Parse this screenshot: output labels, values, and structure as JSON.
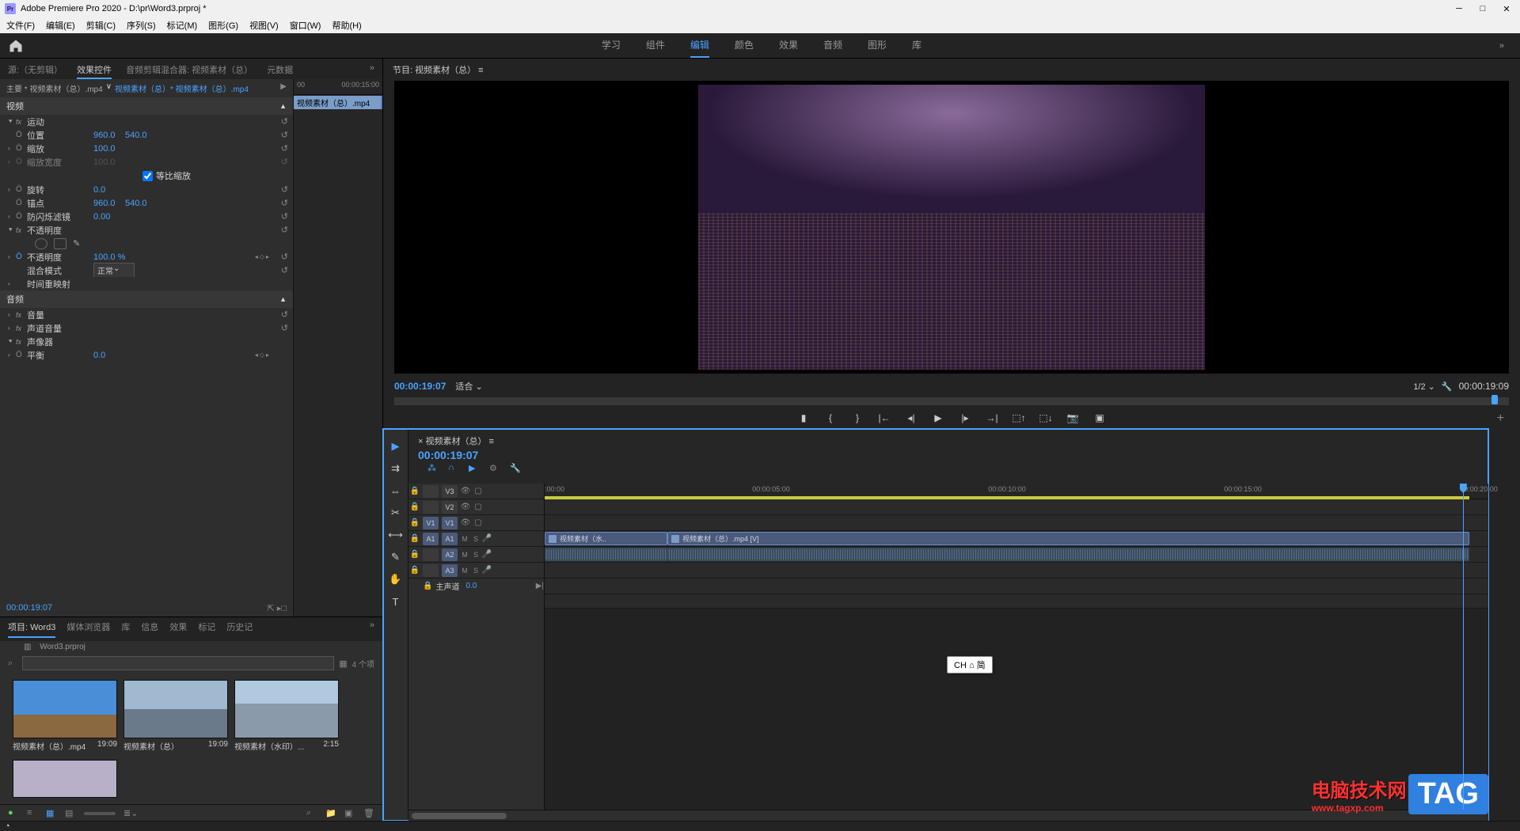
{
  "app": {
    "title": "Adobe Premiere Pro 2020 - D:\\pr\\Word3.prproj *"
  },
  "menu": [
    "文件(F)",
    "编辑(E)",
    "剪辑(C)",
    "序列(S)",
    "标记(M)",
    "图形(G)",
    "视图(V)",
    "窗口(W)",
    "帮助(H)"
  ],
  "workspaces": [
    "学习",
    "组件",
    "编辑",
    "颜色",
    "效果",
    "音频",
    "图形",
    "库"
  ],
  "workspace_active": "编辑",
  "source_tabs": [
    "源:（无剪辑）",
    "效果控件",
    "音频剪辑混合器: 视频素材（总）",
    "元数据"
  ],
  "source_active": "效果控件",
  "clip_path": {
    "master": "主要 * 视频素材（总）.mp4",
    "sequence": "视频素材（总）* 视频素材（总）.mp4"
  },
  "fx": {
    "ruler_start": "00",
    "ruler_end": "00:00:15:00",
    "clip_name": "视频素材（总）.mp4",
    "video_header": "视频",
    "motion": {
      "name": "运动",
      "position": {
        "label": "位置",
        "x": "960.0",
        "y": "540.0"
      },
      "scale": {
        "label": "缩放",
        "val": "100.0"
      },
      "scale_w": {
        "label": "缩放宽度",
        "val": "100.0"
      },
      "uniform": {
        "label": "等比缩放",
        "checked": true
      },
      "rotation": {
        "label": "旋转",
        "val": "0.0"
      },
      "anchor": {
        "label": "锚点",
        "x": "960.0",
        "y": "540.0"
      },
      "flicker": {
        "label": "防闪烁滤镜",
        "val": "0.00"
      }
    },
    "opacity": {
      "name": "不透明度",
      "label": "不透明度",
      "val": "100.0 %",
      "blend_label": "混合模式",
      "blend_val": "正常"
    },
    "time_remap": {
      "name": "时间重映射"
    },
    "audio_header": "音频",
    "volume": {
      "name": "音量"
    },
    "channel_vol": {
      "name": "声道音量"
    },
    "panner": {
      "name": "声像器",
      "balance_label": "平衡",
      "balance_val": "0.0"
    }
  },
  "effect_timecode": "00:00:19:07",
  "program": {
    "title": "节目: 视频素材（总）",
    "timecode_left": "00:00:19:07",
    "fit": "适合",
    "scale": "1/2",
    "timecode_right": "00:00:19:09"
  },
  "project_tabs": [
    "项目: Word3",
    "媒体浏览器",
    "库",
    "信息",
    "效果",
    "标记",
    "历史记"
  ],
  "project_active": "项目: Word3",
  "project_file": "Word3.prproj",
  "item_count": "4 个项",
  "bin_items": [
    {
      "name": "视频素材（总）.mp4",
      "dur": "19:09",
      "thumb": "sky"
    },
    {
      "name": "视频素材（总）",
      "dur": "19:09",
      "thumb": "city1"
    },
    {
      "name": "视频素材（水印）...",
      "dur": "2:15",
      "thumb": "city2"
    },
    {
      "name": "",
      "dur": "",
      "thumb": "seq"
    }
  ],
  "timeline": {
    "title": "视频素材（总）",
    "timecode": "00:00:19:07",
    "ruler": [
      ":00:00",
      "00:00:05:00",
      "00:00:10:00",
      "00:00:15:00",
      "00:00:20:00"
    ],
    "master_label": "主声道",
    "master_val": "0.0",
    "tracks": {
      "v3": "V3",
      "v2": "V2",
      "v1": "V1",
      "a1": "A1",
      "a2": "A2",
      "a3": "A3"
    },
    "clips": {
      "v1_a": "视频素材（水..",
      "v1_b": "视频素材（总）.mp4 [V]"
    },
    "tooltip": "CH ⌂ 简"
  },
  "overlay": {
    "red_text": "电脑技术网",
    "url": "www.tagxp.com",
    "tag": "TAG"
  },
  "colors": {
    "blue": "#4aa3ff",
    "bg": "#232323",
    "panel": "#2e2e2e"
  }
}
